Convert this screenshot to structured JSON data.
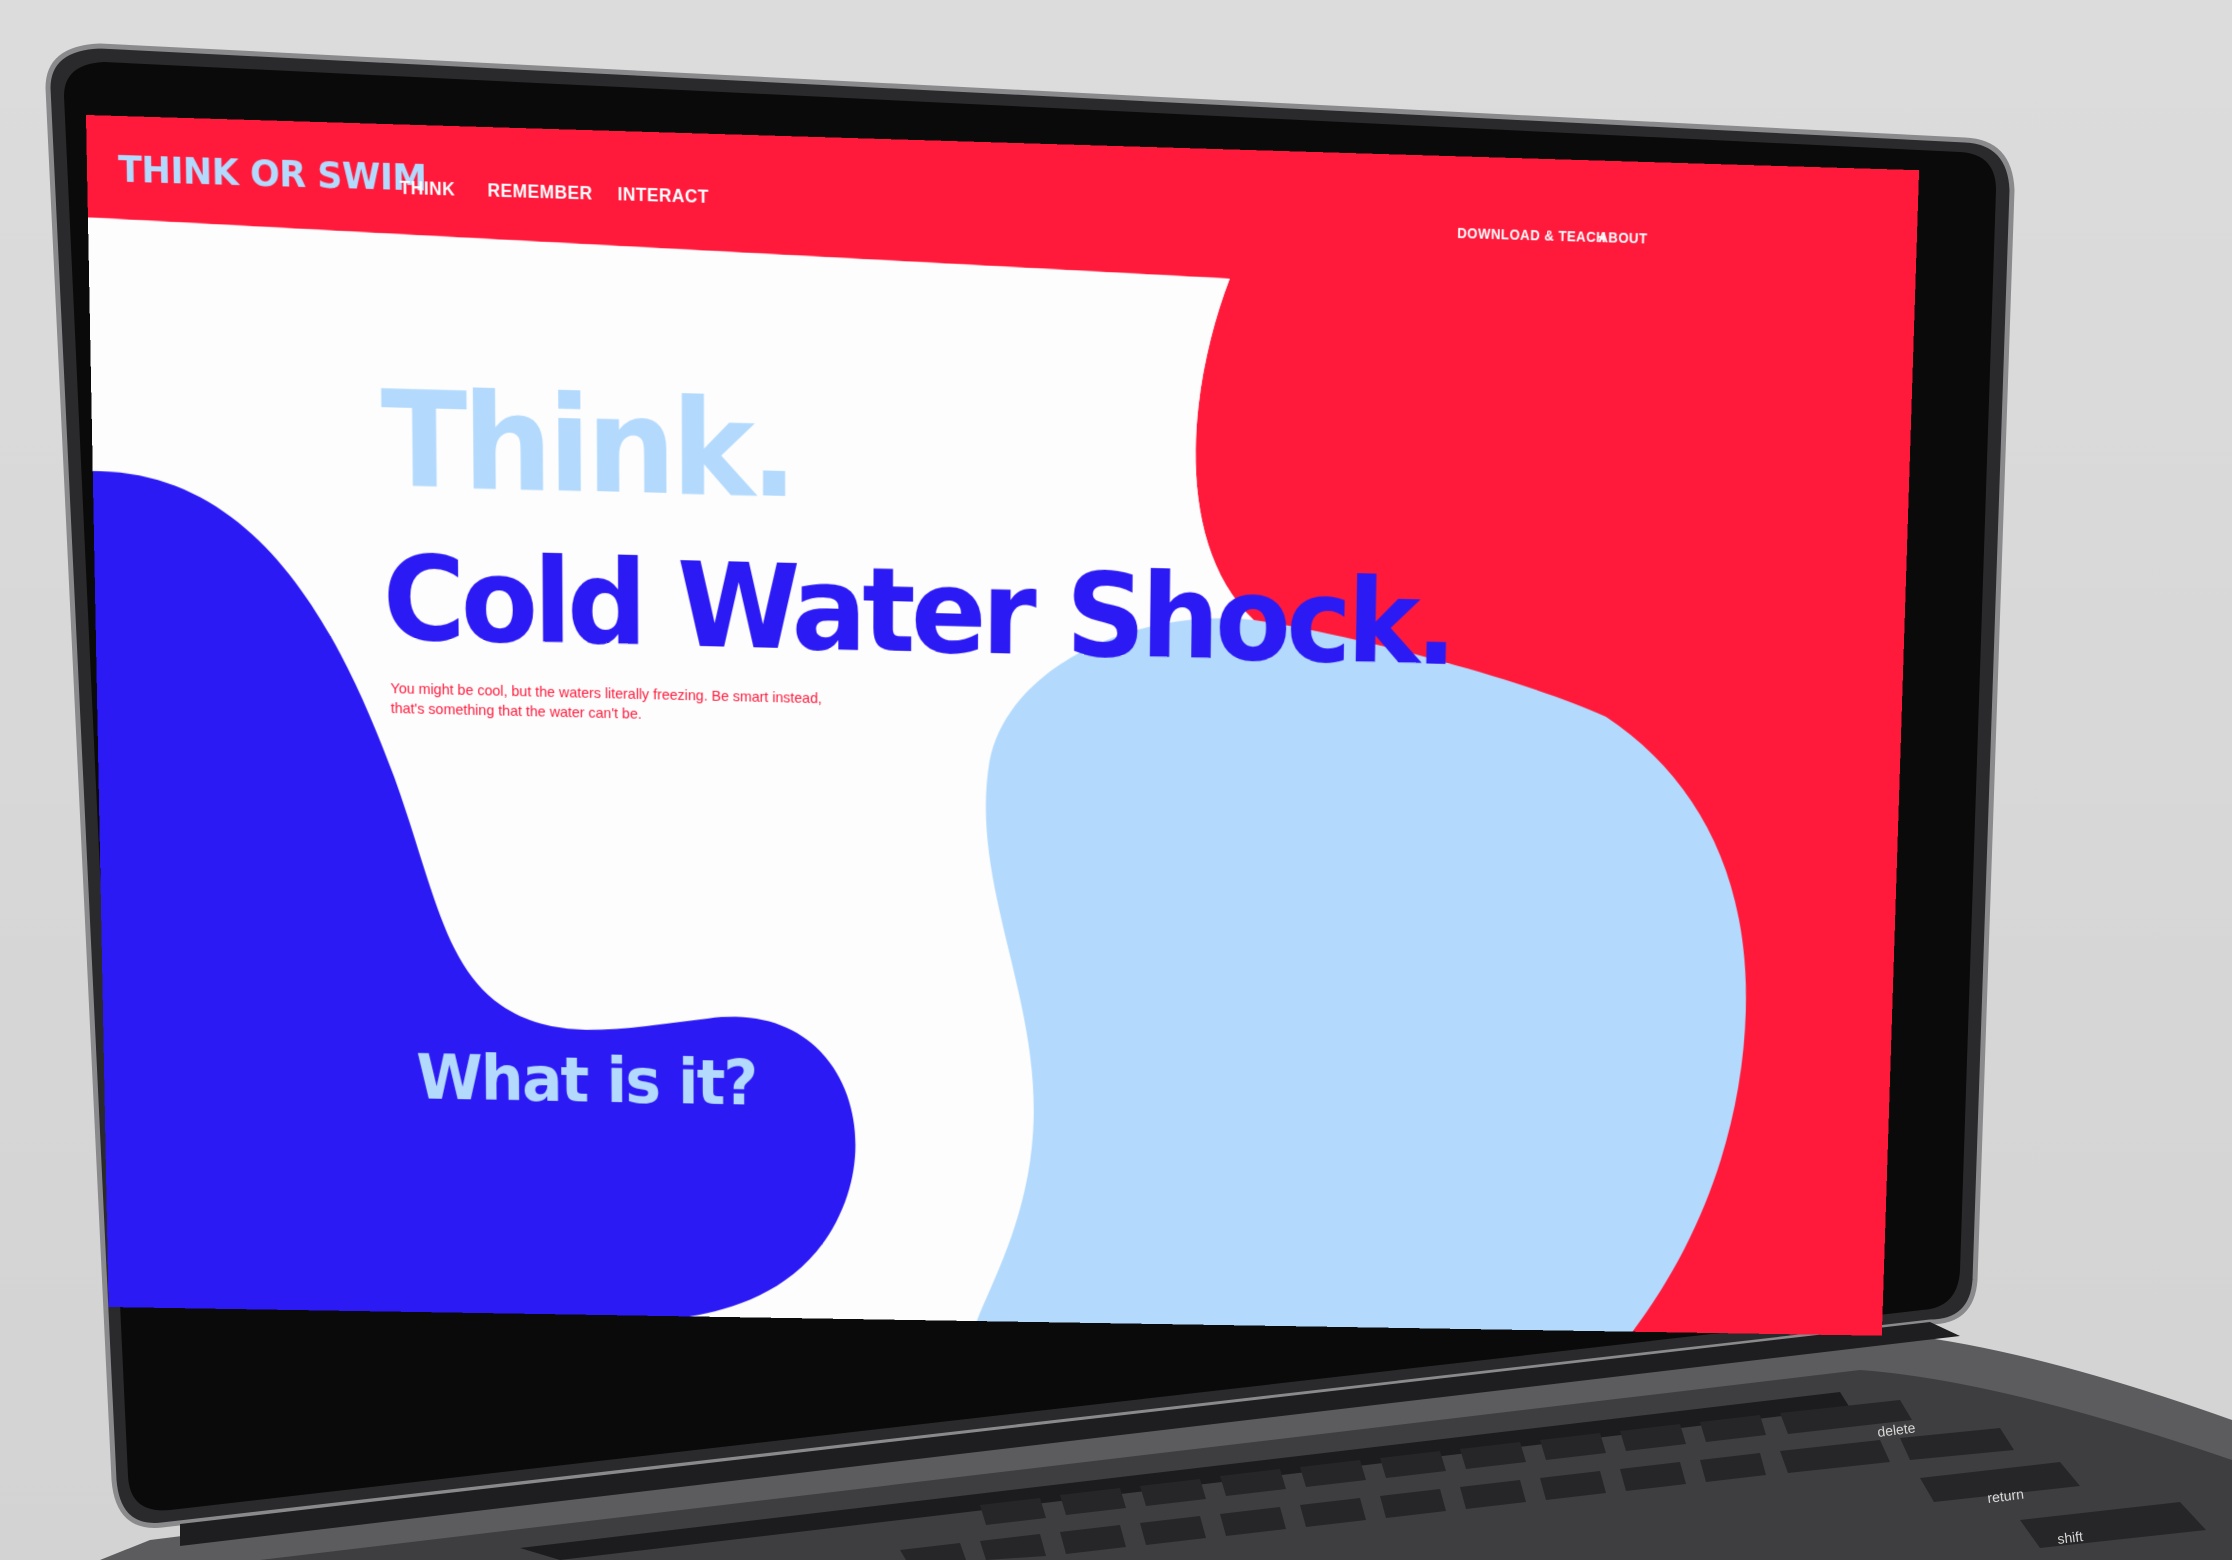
{
  "nav": {
    "logo": "THINK OR SWIM",
    "left_links": [
      "THINK",
      "REMEMBER",
      "INTERACT"
    ],
    "right_links": [
      "DOWNLOAD & TEACH",
      "ABOUT"
    ]
  },
  "hero": {
    "kicker": "Think.",
    "title": "Cold Water Shock.",
    "body_line1": "You might be cool, but the waters literally freezing. Be smart instead,",
    "body_line2": "that's something that the water can't be."
  },
  "section": {
    "question": "What is it?"
  },
  "colors": {
    "red": "#ff1a3c",
    "blue": "#2c1af5",
    "light_blue": "#b3dafd",
    "white": "#fdfdfd",
    "laptop": "#2b2b2d",
    "keyboard": "#4a4a4c"
  },
  "keyboard": {
    "key_labels": [
      "delete",
      "return",
      "shift"
    ]
  }
}
